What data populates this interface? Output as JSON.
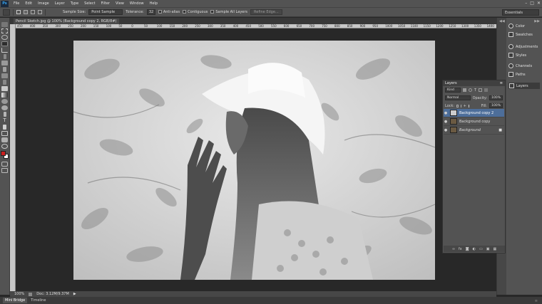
{
  "app": {
    "logo": "Ps"
  },
  "menu": [
    "File",
    "Edit",
    "Image",
    "Layer",
    "Type",
    "Select",
    "Filter",
    "View",
    "Window",
    "Help"
  ],
  "window_controls": [
    "–",
    "□",
    "✕"
  ],
  "options": {
    "sample_size_label": "Sample Size:",
    "sample_size_value": "Point Sample",
    "tolerance_label": "Tolerance:",
    "tolerance_value": "32",
    "anti_alias": "Anti-alias",
    "contiguous": "Contiguous",
    "sample_all_layers": "Sample All Layers",
    "refine_edge": "Refine Edge...",
    "workspace": "Essentials"
  },
  "document": {
    "tab_title": "Pencil Sketch.jpg @ 100% (Background copy 2, RGB/8#) *",
    "ruler_ticks": [
      "450",
      "400",
      "350",
      "300",
      "250",
      "200",
      "150",
      "100",
      "50",
      "0",
      "50",
      "100",
      "150",
      "200",
      "250",
      "300",
      "350",
      "400",
      "450",
      "500",
      "550",
      "600",
      "650",
      "700",
      "750",
      "800",
      "850",
      "900",
      "950",
      "1000",
      "1050",
      "1100",
      "1150",
      "1200",
      "1250",
      "1300",
      "1350",
      "1400"
    ]
  },
  "status": {
    "zoom": "100%",
    "doc": "Doc: 3.12M/9.37M"
  },
  "bottom_tabs": [
    "Mini Bridge",
    "Timeline"
  ],
  "dock": [
    {
      "label": "Color",
      "icon": "color-icon"
    },
    {
      "label": "Swatches",
      "icon": "swatches-icon"
    },
    {
      "label": "Adjustments",
      "icon": "adjustments-icon"
    },
    {
      "label": "Styles",
      "icon": "styles-icon"
    },
    {
      "label": "Channels",
      "icon": "channels-icon"
    },
    {
      "label": "Paths",
      "icon": "paths-icon"
    },
    {
      "label": "Layers",
      "icon": "layers-icon"
    }
  ],
  "layers_panel": {
    "title": "Layers",
    "filter_kind": "Kind",
    "blend_mode": "Normal",
    "opacity_label": "Opacity:",
    "opacity_value": "100%",
    "lock_label": "Lock:",
    "fill_label": "Fill:",
    "fill_value": "100%",
    "layers": [
      {
        "name": "Background copy 2",
        "active": true
      },
      {
        "name": "Background copy",
        "active": false
      },
      {
        "name": "Background",
        "active": false,
        "locked": true
      }
    ]
  },
  "colors": {
    "accent": "#4d6e9a",
    "panel": "#535353",
    "canvas_bg": "#282828",
    "foreground": "#cc1f1f",
    "background": "#ffffff"
  }
}
